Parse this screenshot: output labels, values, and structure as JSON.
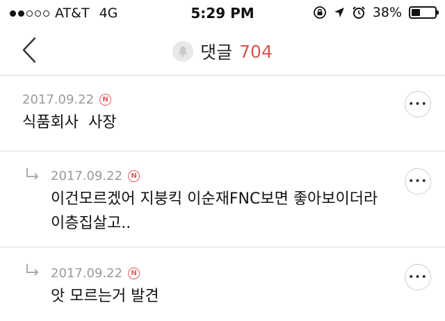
{
  "status": {
    "carrier": "AT&T",
    "network": "4G",
    "time": "5:29 PM",
    "battery": "38%",
    "battery_level": 0.38,
    "signal_bars": 2
  },
  "header": {
    "title": "댓글",
    "count": "704",
    "accent": "#d9534f"
  },
  "comments": [
    {
      "date": "2017.09.22",
      "badge": "N",
      "text": "식품회사  사장",
      "is_reply": false
    },
    {
      "date": "2017.09.22",
      "badge": "N",
      "text": "이건모르겠어 지붕킥 이순재FNC보면 좋아보이더라",
      "text2": "이층집살고..",
      "is_reply": true
    },
    {
      "date": "2017.09.22",
      "badge": "N",
      "text": "앗 모르는거 발견",
      "is_reply": true
    }
  ],
  "more_label": "•••"
}
